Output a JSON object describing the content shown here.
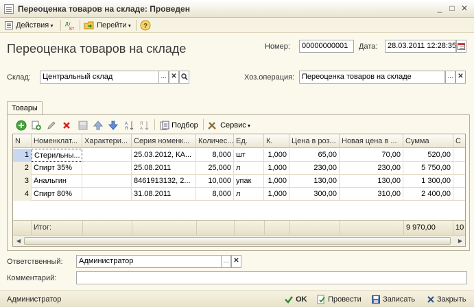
{
  "window": {
    "title": "Переоценка товаров на складе: Проведен"
  },
  "toolbar": {
    "actions_label": "Действия",
    "goto_label": "Перейти",
    "dt_kt": "Дт Кт"
  },
  "form": {
    "title": "Переоценка товаров на складе",
    "number_label": "Номер:",
    "number_value": "00000000001",
    "date_label": "Дата:",
    "date_value": "28.03.2011 12:28:35",
    "warehouse_label": "Склад:",
    "warehouse_value": "Центральный склад",
    "operation_label": "Хоз.операция:",
    "operation_value": "Переоценка товаров на складе",
    "responsible_label": "Ответственный:",
    "responsible_value": "Администратор",
    "comment_label": "Комментарий:",
    "comment_value": ""
  },
  "tabs": [
    {
      "label": "Товары"
    }
  ],
  "grid_toolbar": {
    "selection_label": "Подбор",
    "service_label": "Сервис"
  },
  "grid": {
    "columns": [
      "N",
      "Номенклат...",
      "Характери...",
      "Серия номенк...",
      "Количес...",
      "Ед.",
      "К.",
      "Цена в роз...",
      "Новая цена в ...",
      "Сумма",
      "С"
    ],
    "rows": [
      [
        "1",
        "Стерильны...",
        "",
        "25.03.2012, КА...",
        "8,000",
        "шт",
        "1,000",
        "65,00",
        "70,00",
        "520,00"
      ],
      [
        "2",
        "Спирт 35%",
        "",
        "25.08.2011",
        "25,000",
        "л",
        "1,000",
        "230,00",
        "230,00",
        "5 750,00"
      ],
      [
        "3",
        "Анальгин",
        "",
        "8461913132, 2...",
        "10,000",
        "упак",
        "1,000",
        "130,00",
        "130,00",
        "1 300,00"
      ],
      [
        "4",
        "Спирт 80%",
        "",
        "31.08.2011",
        "8,000",
        "л",
        "1,000",
        "300,00",
        "310,00",
        "2 400,00"
      ]
    ],
    "footer_label": "Итог:",
    "footer_total": "9 970,00",
    "footer_extra": "10"
  },
  "statusbar": {
    "user": "Администратор",
    "ok_label": "OK",
    "post_label": "Провести",
    "save_label": "Записать",
    "close_label": "Закрыть"
  }
}
